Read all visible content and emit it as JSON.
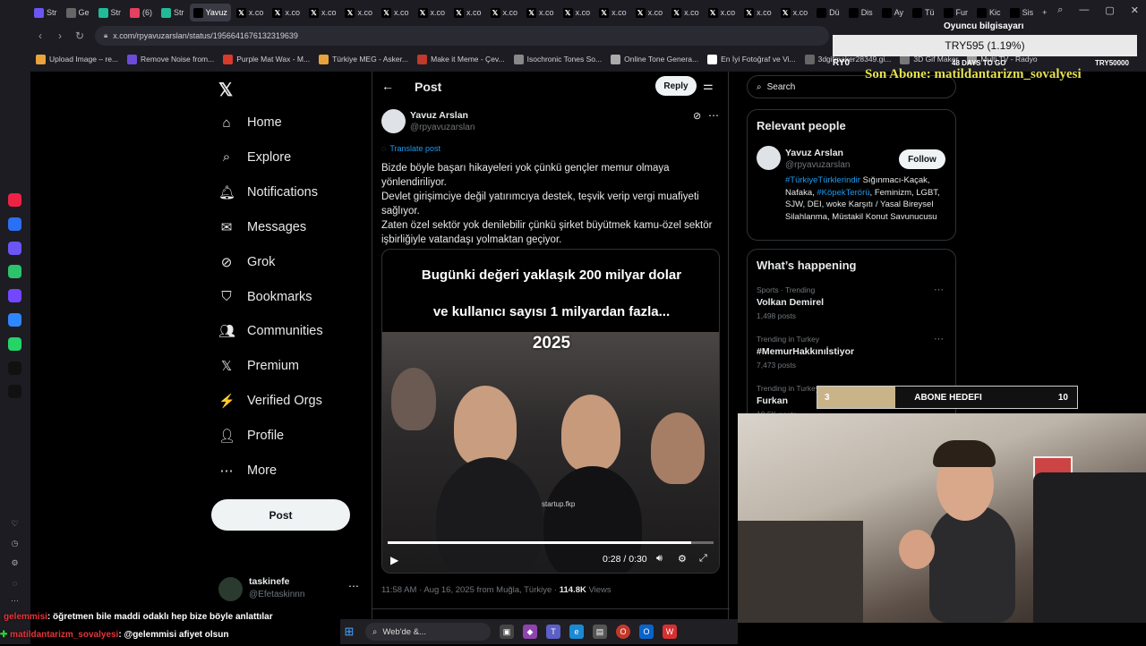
{
  "browser": {
    "tabs": [
      "Str",
      "Ge",
      "Str",
      "(6)",
      "Str",
      "Yavuz",
      "x.co",
      "x.co",
      "x.co",
      "x.co",
      "x.co",
      "x.co",
      "x.co",
      "x.co",
      "x.co",
      "x.co",
      "x.co",
      "x.co",
      "x.co",
      "x.co",
      "x.co",
      "x.co",
      "Dü",
      "Dis",
      "Ay",
      "Tü",
      "Fur",
      "Kic",
      "Sis"
    ],
    "active_tab_index": 5,
    "url": "x.com/rpyavuzarslan/status/1956641676132319639",
    "bookmarks": [
      "Upload Image – re...",
      "Remove Noise from...",
      "Purple Mat Wax - M...",
      "Türkiye MEG - Asker...",
      "Make it Meme - Çev...",
      "Isochronic Tones So...",
      "Online Tone Genera...",
      "En İyi Fotoğraf ve Vi...",
      "3dgifmaker28349.gi...",
      "3D Gif Maker",
      "Multi TV - Radyo"
    ],
    "bookmark_colors": [
      "#e8a33d",
      "#6d4bd8",
      "#d83b2b",
      "#e8a33d",
      "#c0392b",
      "#888",
      "#aaa",
      "#fff",
      "#666",
      "#777",
      "#999"
    ]
  },
  "rail_colors": [
    "#e24",
    "#2b6ff2",
    "#6b55f5",
    "#2cc36b",
    "#7247ff",
    "#2f86ff",
    "#25d366",
    "#111",
    "#111",
    "#1db954",
    "#2f6ff2"
  ],
  "x_sidebar": {
    "items": [
      {
        "icon": "⌂",
        "label": "Home"
      },
      {
        "icon": "⌕",
        "label": "Explore"
      },
      {
        "icon": "🔔︎",
        "label": "Notifications"
      },
      {
        "icon": "✉",
        "label": "Messages"
      },
      {
        "icon": "⊘",
        "label": "Grok"
      },
      {
        "icon": "⛉",
        "label": "Bookmarks"
      },
      {
        "icon": "👥︎",
        "label": "Communities"
      },
      {
        "icon": "𝕏",
        "label": "Premium"
      },
      {
        "icon": "⚡",
        "label": "Verified Orgs"
      },
      {
        "icon": "👤︎",
        "label": "Profile"
      },
      {
        "icon": "⋯",
        "label": "More"
      }
    ],
    "post_label": "Post",
    "account": {
      "name": "taskinefe",
      "handle": "@Efetaskinnn"
    }
  },
  "post": {
    "header_title": "Post",
    "reply_label": "Reply",
    "author_name": "Yavuz Arslan",
    "author_handle": "@rpyavuzarslan",
    "translate_label": "Translate post",
    "body_lines": [
      "Bizde böyle başarı hikayeleri yok çünkü gençler memur olmaya yönlendiriliyor.",
      "Devlet girişimciye değil yatırımcıya destek, teşvik verip vergi muafiyeti sağlıyor.",
      "Zaten özel sektör yok denilebilir çünkü şirket büyütmek kamu-özel sektör işbirliğiyle vatandaşı yolmaktan geçiyor."
    ],
    "video": {
      "caption_line1": "Bugünki değeri yaklaşık 200 milyar dolar",
      "caption_line2": "ve kullanıcı sayısı 1 milyardan fazla...",
      "year_label": "2025",
      "time": "0:28 / 0:30",
      "progress": 0.93,
      "watermark": "startup.fkp"
    },
    "meta_time": "11:58 AM · Aug 16, 2025 from Muğla, Türkiye · ",
    "views_count": "114.8K",
    "views_label": " Views"
  },
  "right": {
    "search_placeholder": "Search",
    "relevant_title": "Relevant people",
    "rp_name": "Yavuz Arslan",
    "rp_handle": "@rpyavuzarslan",
    "follow_label": "Follow",
    "rp_bio_tag1": "#TürkiyeTürklerindir",
    "rp_bio_mid": " Sığınmacı-Kaçak, Nafaka, ",
    "rp_bio_tag2": "#KöpekTerörü",
    "rp_bio_rest": ", Feminizm, LGBT, SJW, DEI, woke Karşıtı / Yasal Bireysel Silahlanma, Müstakil Konut Savunucusu",
    "happening_title": "What’s happening",
    "trends": [
      {
        "meta": "Sports · Trending",
        "title": "Volkan Demirel",
        "posts": "1,498 posts"
      },
      {
        "meta": "Trending in Turkey",
        "title": "#MemurHakkınıİstiyor",
        "posts": "7,473 posts"
      },
      {
        "meta": "Trending in Turkey",
        "title": "Furkan",
        "posts": "19.5K posts"
      }
    ]
  },
  "overlay": {
    "top_label": "Oyuncu bilgisayarı",
    "price": "TRY595 (1.19%)",
    "left_code": "RY0",
    "days_left": "48 DAYS TO GO",
    "goal": "TRY50000",
    "last_sub": "Son Abone: matildantarizm_sovalyesi",
    "abone_current": "3",
    "abone_label": "ABONE HEDEFI",
    "abone_target": "10",
    "abone_progress": 0.3
  },
  "chat": [
    {
      "user": "gelemmisi",
      "text": ": öğretmen bile maddi odaklı hep bize böyle anlattılar",
      "color": "#e8343a"
    },
    {
      "user": "matildantarizm_sovalyesi",
      "text": ": @gelemmisi afiyet olsun",
      "color": "#e8343a"
    }
  ],
  "taskbar": {
    "search_label": "Web'de &..."
  }
}
